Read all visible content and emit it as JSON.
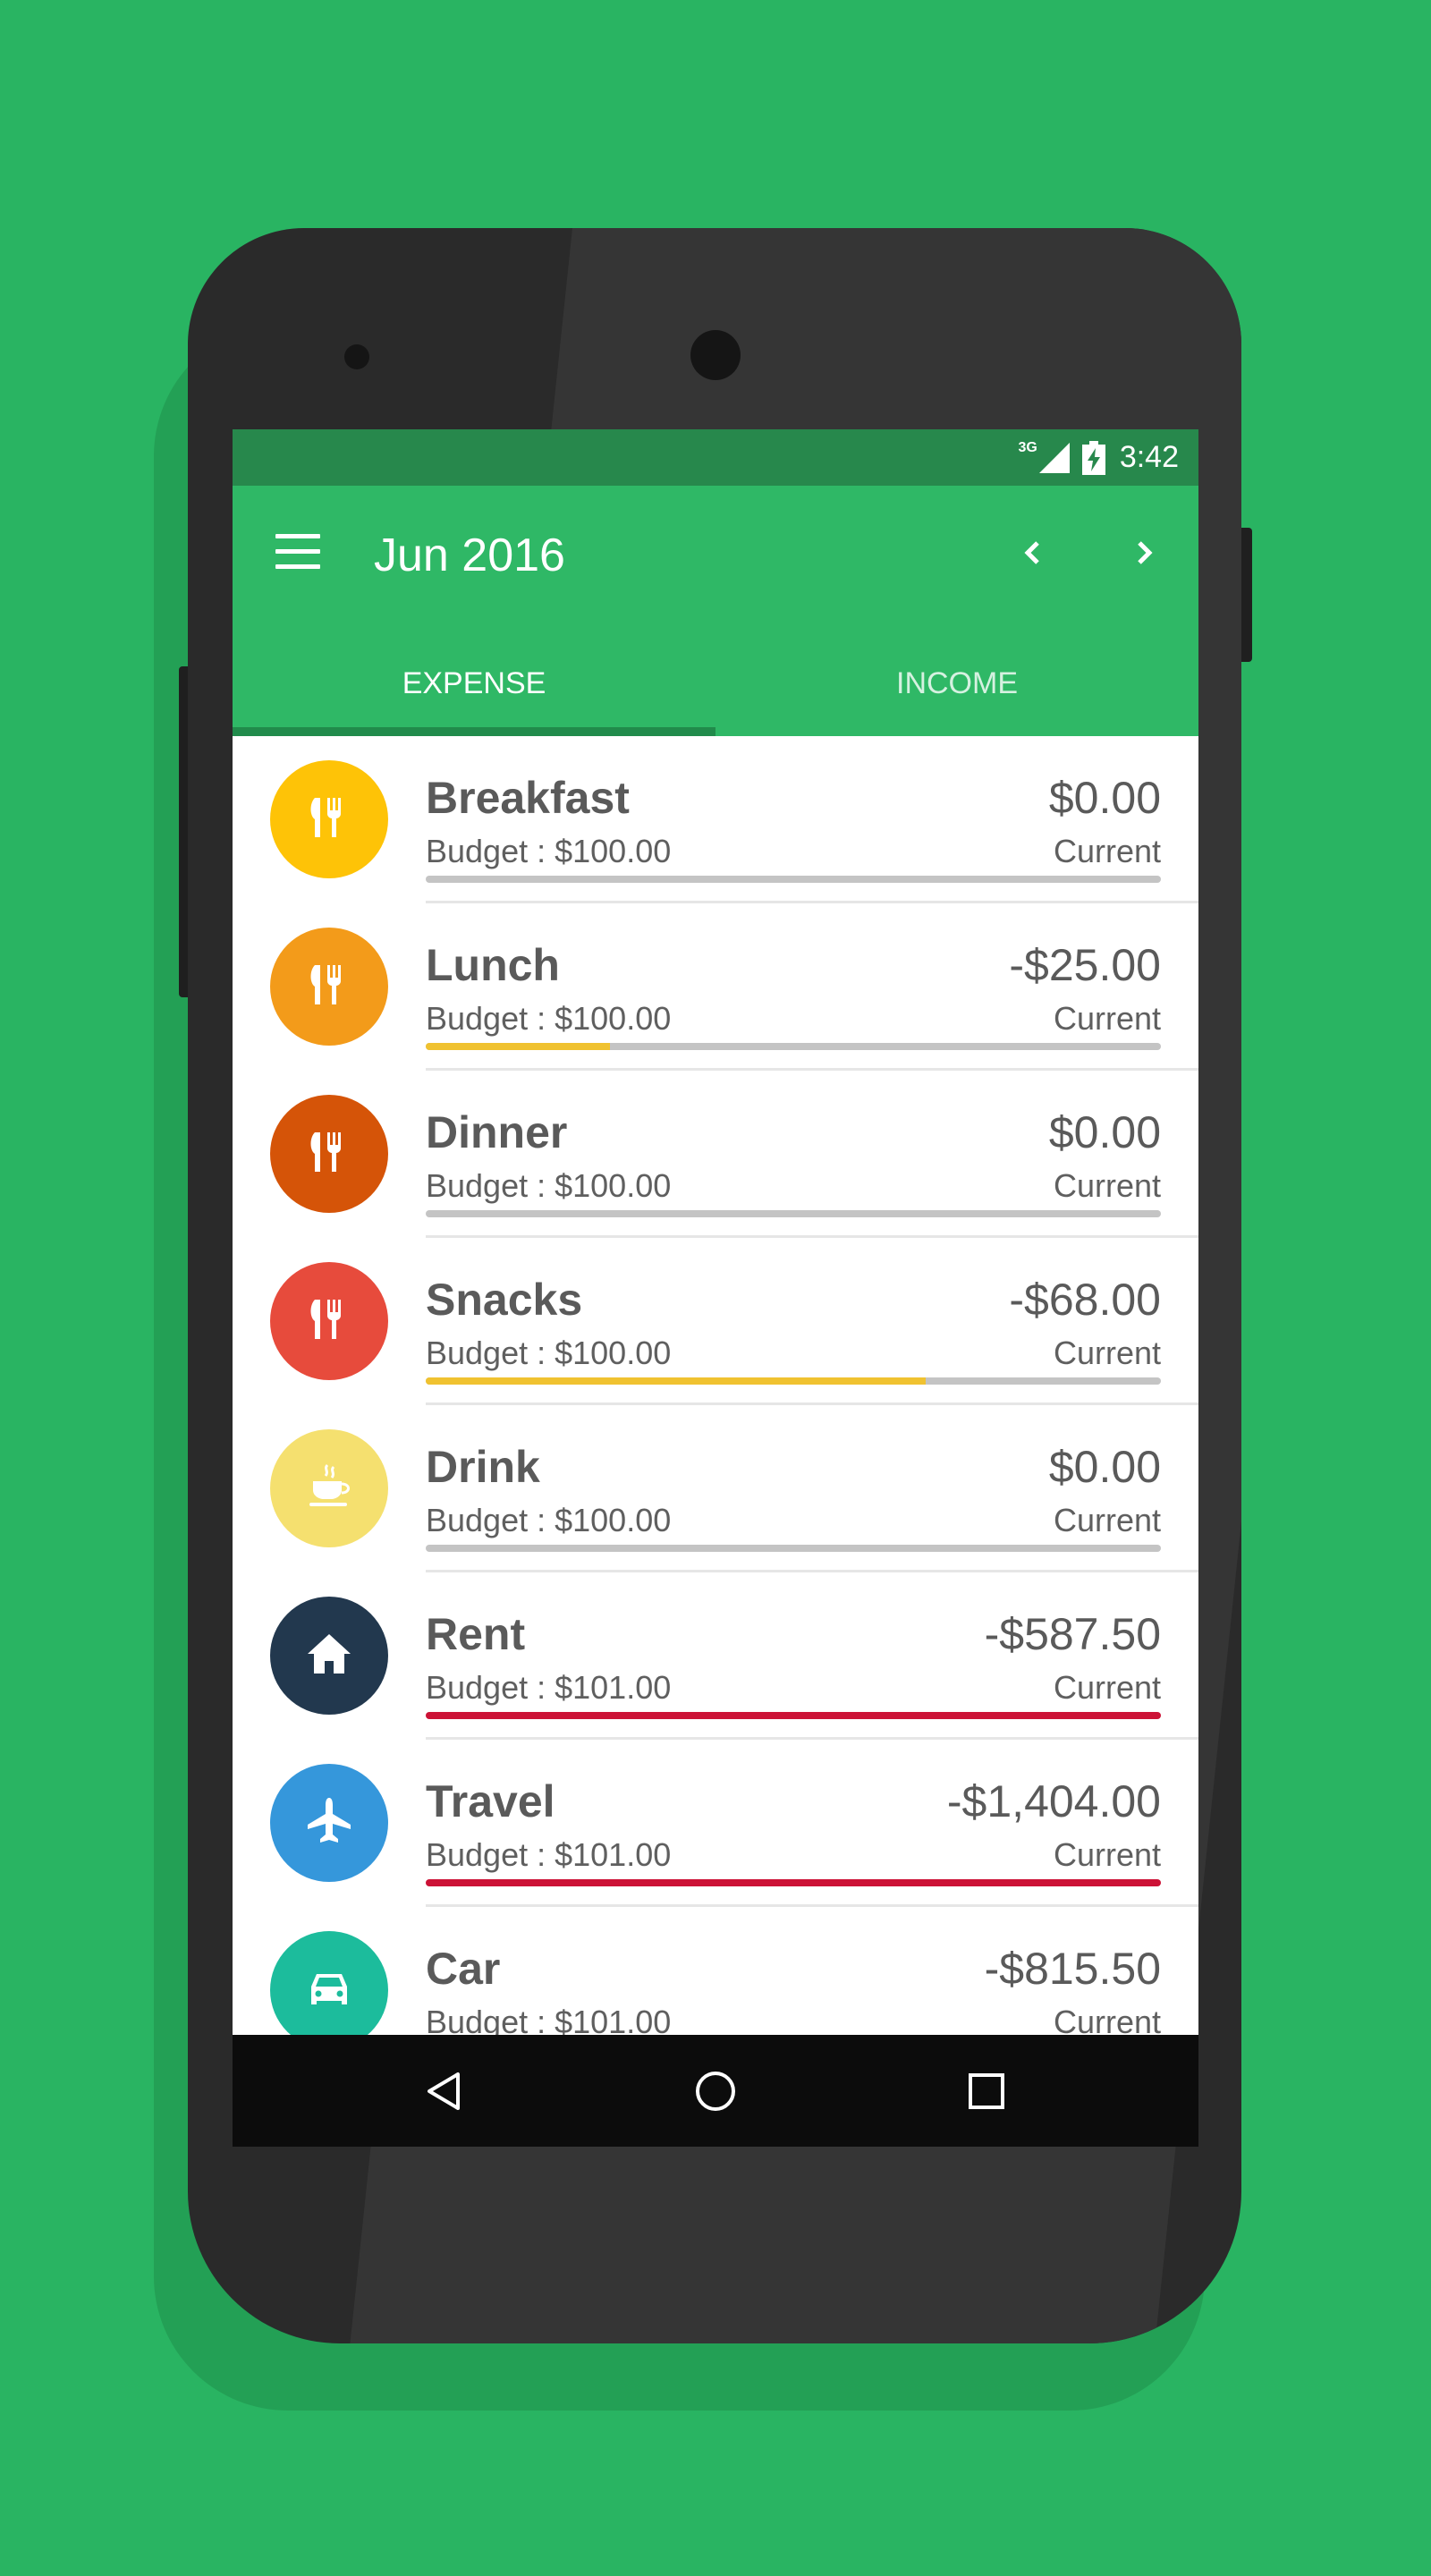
{
  "status": {
    "network": "3G",
    "time": "3:42"
  },
  "app_bar": {
    "title": "Jun 2016"
  },
  "tabs": [
    {
      "label": "EXPENSE",
      "active": true
    },
    {
      "label": "INCOME",
      "active": false
    }
  ],
  "items": [
    {
      "name": "Breakfast",
      "amount": "$0.00",
      "budget": "Budget : $100.00",
      "status": "Current",
      "icon": "utensils-icon",
      "icon_color": "#fec307",
      "progress": 0,
      "bar_color": "#f0c230"
    },
    {
      "name": "Lunch",
      "amount": "-$25.00",
      "budget": "Budget : $100.00",
      "status": "Current",
      "icon": "utensils-icon",
      "icon_color": "#f39b1a",
      "progress": 0.25,
      "bar_color": "#f0c230"
    },
    {
      "name": "Dinner",
      "amount": "$0.00",
      "budget": "Budget : $100.00",
      "status": "Current",
      "icon": "utensils-icon",
      "icon_color": "#d55408",
      "progress": 0,
      "bar_color": "#f0c230"
    },
    {
      "name": "Snacks",
      "amount": "-$68.00",
      "budget": "Budget : $100.00",
      "status": "Current",
      "icon": "utensils-icon",
      "icon_color": "#e74b3c",
      "progress": 0.68,
      "bar_color": "#f0c230"
    },
    {
      "name": "Drink",
      "amount": "$0.00",
      "budget": "Budget : $100.00",
      "status": "Current",
      "icon": "coffee-cup-icon",
      "icon_color": "#f5e06f",
      "progress": 0,
      "bar_color": "#f0c230"
    },
    {
      "name": "Rent",
      "amount": "-$587.50",
      "budget": "Budget : $101.00",
      "status": "Current",
      "icon": "home-icon",
      "icon_color": "#22384e",
      "progress": 1,
      "bar_color": "#cc1236"
    },
    {
      "name": "Travel",
      "amount": "-$1,404.00",
      "budget": "Budget : $101.00",
      "status": "Current",
      "icon": "airplane-icon",
      "icon_color": "#3597db",
      "progress": 1,
      "bar_color": "#cc1236"
    },
    {
      "name": "Car",
      "amount": "-$815.50",
      "budget": "Budget : $101.00",
      "status": "Current",
      "icon": "car-icon",
      "icon_color": "#1cbc9c",
      "progress": 1,
      "bar_color": "#cc1236"
    }
  ]
}
